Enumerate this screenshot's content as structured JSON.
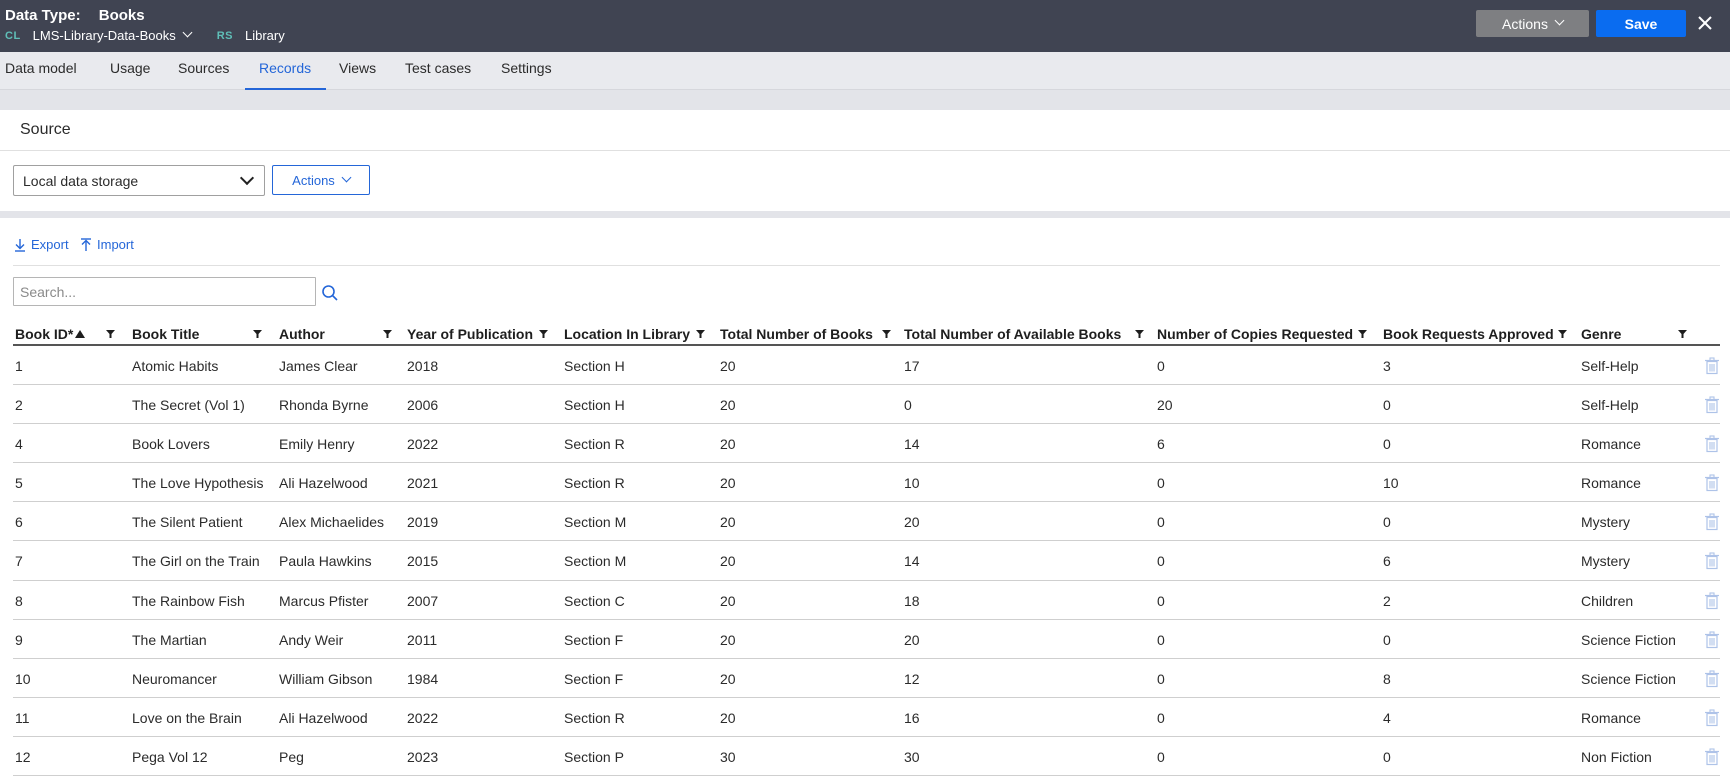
{
  "header": {
    "data_type_label": "Data Type:",
    "data_type_value": "Books",
    "cl_badge": "CL",
    "class_name": "LMS-Library-Data-Books",
    "rs_badge": "RS",
    "ruleset": "Library",
    "actions_label": "Actions",
    "save_label": "Save"
  },
  "tabs": [
    {
      "label": "Data model"
    },
    {
      "label": "Usage"
    },
    {
      "label": "Sources"
    },
    {
      "label": "Records",
      "active": true
    },
    {
      "label": "Views"
    },
    {
      "label": "Test cases"
    },
    {
      "label": "Settings"
    }
  ],
  "source": {
    "title": "Source",
    "selected": "Local data storage",
    "actions_label": "Actions"
  },
  "records": {
    "export_label": "Export",
    "import_label": "Import",
    "search_placeholder": "Search..."
  },
  "table": {
    "columns": [
      "Book ID*",
      "Book Title",
      "Author",
      "Year of Publication",
      "Location In Library",
      "Total Number of Books",
      "Total Number of Available Books",
      "Number of Copies Requested",
      "Book Requests Approved",
      "Genre"
    ],
    "rows": [
      [
        "1",
        "Atomic Habits",
        "James Clear",
        "2018",
        "Section H",
        "20",
        "17",
        "0",
        "3",
        "Self-Help"
      ],
      [
        "2",
        "The Secret (Vol 1)",
        "Rhonda Byrne",
        "2006",
        "Section H",
        "20",
        "0",
        "20",
        "0",
        "Self-Help"
      ],
      [
        "4",
        "Book Lovers",
        "Emily Henry",
        "2022",
        "Section R",
        "20",
        "14",
        "6",
        "0",
        "Romance"
      ],
      [
        "5",
        "The Love Hypothesis",
        "Ali Hazelwood",
        "2021",
        "Section R",
        "20",
        "10",
        "0",
        "10",
        "Romance"
      ],
      [
        "6",
        "The Silent Patient",
        "Alex Michaelides",
        "2019",
        "Section M",
        "20",
        "20",
        "0",
        "0",
        "Mystery"
      ],
      [
        "7",
        "The Girl on the Train",
        "Paula Hawkins",
        "2015",
        "Section M",
        "20",
        "14",
        "0",
        "6",
        "Mystery"
      ],
      [
        "8",
        "The Rainbow Fish",
        "Marcus Pfister",
        "2007",
        "Section C",
        "20",
        "18",
        "0",
        "2",
        "Children"
      ],
      [
        "9",
        "The Martian",
        "Andy Weir",
        "2011",
        "Section F",
        "20",
        "20",
        "0",
        "0",
        "Science Fiction"
      ],
      [
        "10",
        "Neuromancer",
        "William Gibson",
        "1984",
        "Section F",
        "20",
        "12",
        "0",
        "8",
        "Science Fiction"
      ],
      [
        "11",
        "Love on the Brain",
        "Ali Hazelwood",
        "2022",
        "Section R",
        "20",
        "16",
        "0",
        "4",
        "Romance"
      ],
      [
        "12",
        "Pega Vol 12",
        "Peg",
        "2023",
        "Section P",
        "30",
        "30",
        "0",
        "0",
        "Non Fiction"
      ]
    ]
  },
  "icons": {
    "close": "close-icon",
    "search": "search-icon",
    "export": "download-icon",
    "import": "upload-icon",
    "filter": "filter-icon",
    "delete": "trash-icon"
  },
  "colors": {
    "header_bg": "#404452",
    "primary": "#0a6cf0",
    "link": "#2466d8",
    "badge": "#5fbfb8"
  }
}
